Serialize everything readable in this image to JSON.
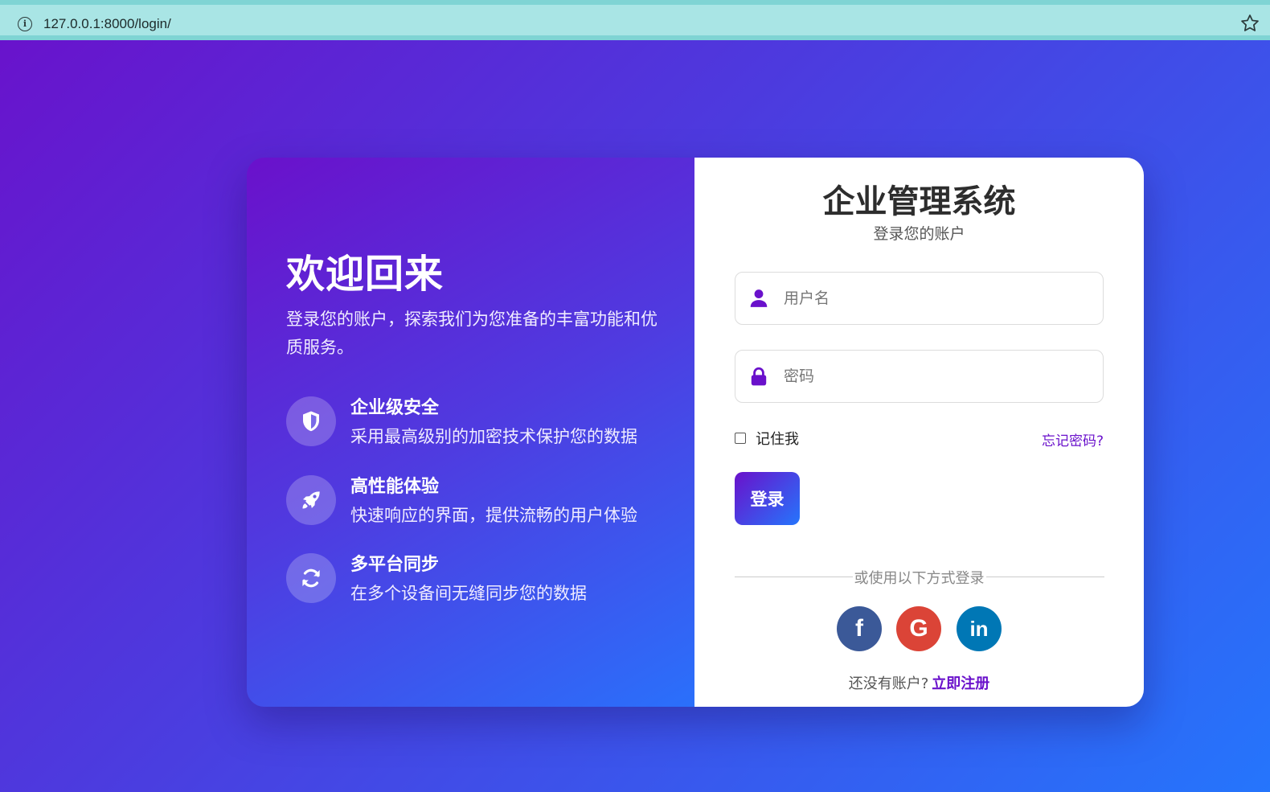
{
  "browser": {
    "url": "127.0.0.1:8000/login/",
    "info_icon": "info-icon",
    "bookmark_icon": "star-icon"
  },
  "left": {
    "title": "欢迎回来",
    "description": "登录您的账户，探索我们为您准备的丰富功能和优质服务。",
    "features": [
      {
        "icon": "shield-icon",
        "title": "企业级安全",
        "desc": "采用最高级别的加密技术保护您的数据"
      },
      {
        "icon": "rocket-icon",
        "title": "高性能体验",
        "desc": "快速响应的界面，提供流畅的用户体验"
      },
      {
        "icon": "sync-icon",
        "title": "多平台同步",
        "desc": "在多个设备间无缝同步您的数据"
      }
    ]
  },
  "right": {
    "title": "企业管理系统",
    "subtitle": "登录您的账户",
    "username_placeholder": "用户名",
    "password_placeholder": "密码",
    "remember_label": "记住我",
    "forgot_label": "忘记密码?",
    "login_label": "登录",
    "divider_text": "或使用以下方式登录",
    "social": [
      {
        "icon": "facebook-icon",
        "glyph": "f"
      },
      {
        "icon": "google-icon",
        "glyph": "G"
      },
      {
        "icon": "linkedin-icon",
        "glyph": "in"
      }
    ],
    "register_prompt": "还没有账户?",
    "register_link": "立即注册"
  },
  "colors": {
    "accent": "#6a11cb",
    "accent2": "#2575fc",
    "facebook": "#3b5998",
    "google": "#db4437",
    "linkedin": "#0077b5"
  }
}
